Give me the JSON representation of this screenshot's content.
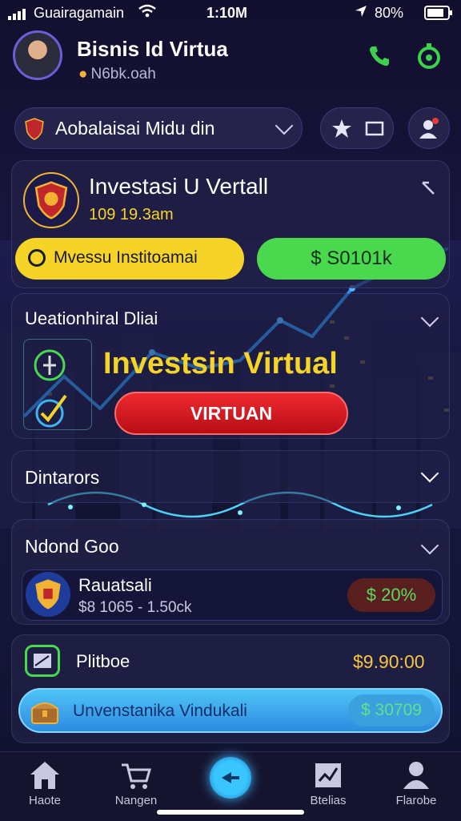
{
  "status_bar": {
    "carrier": "Guairagamain",
    "time": "1:10M",
    "battery": "80%"
  },
  "header": {
    "title": "Bisnis Id Virtua",
    "subtitle": "N6bk.oah"
  },
  "search": {
    "label": "Aobalaisai Midu din"
  },
  "investment_card": {
    "title": "Investasi U Vertall",
    "subtitle": "109 19.3am",
    "yellow_button": "Mvessu Institoamai",
    "green_value": "$ S0101k"
  },
  "promo_card": {
    "label": "Ueationhiral Dliai",
    "headline": "Investsin Virtual",
    "button": "VIRTUAN"
  },
  "section_dintarors": {
    "label": "Dintarors"
  },
  "section_nabond": {
    "label": "Ndond Goo",
    "item": {
      "name": "Rauatsali",
      "range": "$8 1065 - 1.50ck",
      "badge": "$ 20%"
    }
  },
  "section_plitboe": {
    "label": "Plitboe",
    "value": "$9.90:00",
    "bar": {
      "label": "Unvenstanika Vindukali",
      "value": "$ 30709"
    }
  },
  "bottom_nav": [
    {
      "label": "Haote",
      "icon": "home-icon"
    },
    {
      "label": "Nangen",
      "icon": "cart-icon"
    },
    {
      "label": "",
      "icon": "center-action-icon"
    },
    {
      "label": "Btelias",
      "icon": "chart-board-icon"
    },
    {
      "label": "Flarobe",
      "icon": "profile-icon"
    }
  ],
  "colors": {
    "yellow": "#f5d327",
    "green": "#4ad94e",
    "red": "#d9121c",
    "cyan": "#3fb4f0",
    "accent_gold": "#f2b233"
  }
}
